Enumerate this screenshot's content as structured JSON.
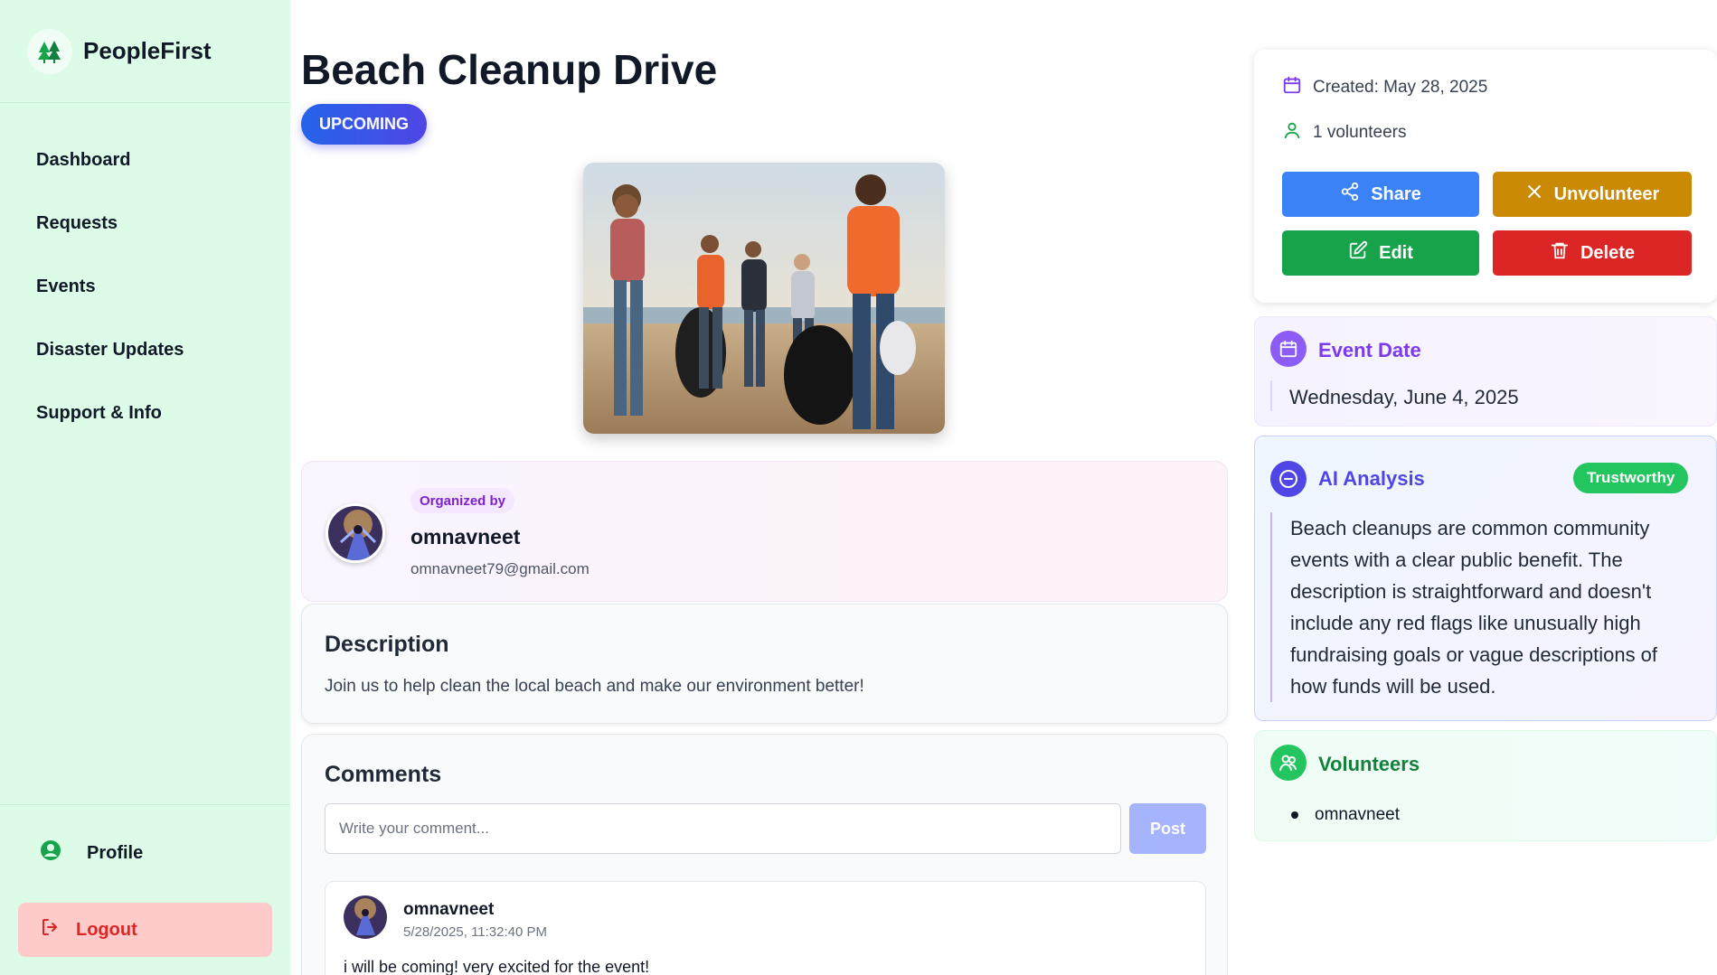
{
  "app": {
    "name": "PeopleFirst"
  },
  "sidebar": {
    "items": [
      {
        "label": "Dashboard"
      },
      {
        "label": "Requests"
      },
      {
        "label": "Events"
      },
      {
        "label": "Disaster Updates"
      },
      {
        "label": "Support & Info"
      }
    ],
    "profile_label": "Profile",
    "logout_label": "Logout"
  },
  "event": {
    "title": "Beach Cleanup Drive",
    "status": "UPCOMING",
    "image_alt": "Volunteers collecting trash on a beach"
  },
  "organizer": {
    "tag": "Organized by",
    "name": "omnavneet",
    "email": "omnavneet79@gmail.com"
  },
  "description": {
    "title": "Description",
    "text": "Join us to help clean the local beach and make our environment better!"
  },
  "comments": {
    "title": "Comments",
    "placeholder": "Write your comment...",
    "post_label": "Post",
    "items": [
      {
        "author": "omnavneet",
        "time": "5/28/2025, 11:32:40 PM",
        "text": "i will be coming! very excited for the event!"
      }
    ]
  },
  "meta": {
    "created": "Created: May 28, 2025",
    "volunteers": "1 volunteers"
  },
  "actions": {
    "share": "Share",
    "unvolunteer": "Unvolunteer",
    "edit": "Edit",
    "delete": "Delete"
  },
  "event_date": {
    "title": "Event Date",
    "value": "Wednesday, June 4, 2025"
  },
  "ai_analysis": {
    "title": "AI Analysis",
    "badge": "Trustworthy",
    "text": "Beach cleanups are common community events with a clear public benefit. The description is straightforward and doesn't include any red flags like unusually high fundraising goals or vague descriptions of how funds will be used."
  },
  "volunteers_panel": {
    "title": "Volunteers",
    "items": [
      "omnavneet"
    ]
  },
  "colors": {
    "sidebar_bg": "#dcfce7",
    "share": "#3b82f6",
    "unvolunteer": "#ca8a04",
    "edit": "#16a34a",
    "delete": "#dc2626",
    "trust_badge": "#22c55e",
    "event_date_accent": "#7c3aed",
    "ai_accent": "#4f46e5",
    "volunteers_accent": "#15803d"
  }
}
